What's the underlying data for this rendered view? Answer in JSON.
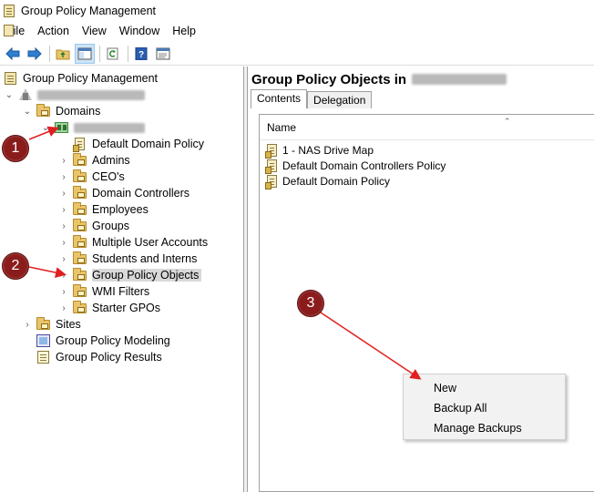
{
  "window": {
    "title": "Group Policy Management"
  },
  "menubar": {
    "items": [
      "File",
      "Action",
      "View",
      "Window",
      "Help"
    ]
  },
  "toolbar": {
    "buttons": [
      "back-icon",
      "forward-icon",
      "up-folder-icon",
      "show-hide-tree-icon",
      "refresh-icon",
      "help-icon",
      "properties-icon"
    ]
  },
  "tree": {
    "root": "Group Policy Management",
    "domains": "Domains",
    "children": [
      {
        "label": "Default Domain Policy",
        "icon": "gpo-link-icon"
      },
      {
        "label": "Admins",
        "icon": "ou-folder-icon"
      },
      {
        "label": "CEO's",
        "icon": "ou-folder-icon"
      },
      {
        "label": "Domain Controllers",
        "icon": "ou-folder-icon"
      },
      {
        "label": "Employees",
        "icon": "ou-folder-icon"
      },
      {
        "label": "Groups",
        "icon": "ou-folder-icon"
      },
      {
        "label": "Multiple User Accounts",
        "icon": "ou-folder-icon"
      },
      {
        "label": "Students and Interns",
        "icon": "ou-folder-icon"
      },
      {
        "label": "Group Policy Objects",
        "icon": "gpo-folder-icon",
        "selected": true
      },
      {
        "label": "WMI Filters",
        "icon": "folder-icon"
      },
      {
        "label": "Starter GPOs",
        "icon": "folder-icon"
      }
    ],
    "sites": "Sites",
    "modeling": "Group Policy Modeling",
    "results": "Group Policy Results"
  },
  "right_pane": {
    "header": "Group Policy Objects in",
    "tabs": [
      "Contents",
      "Delegation"
    ],
    "active_tab": "Contents",
    "column": "Name",
    "items": [
      "1 - NAS Drive Map",
      "Default Domain Controllers Policy",
      "Default Domain Policy"
    ]
  },
  "context_menu": {
    "items": [
      "New",
      "Backup All",
      "Manage Backups"
    ]
  },
  "callouts": [
    "1",
    "2",
    "3"
  ],
  "colors": {
    "callout": "#8b1c1c",
    "arrow": "#e02020",
    "selection": "#d9d9d9"
  }
}
